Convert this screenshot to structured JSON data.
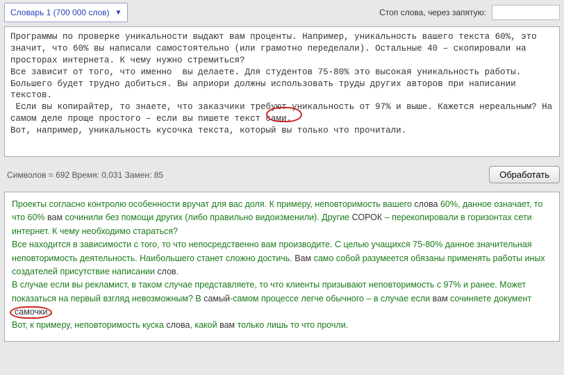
{
  "header": {
    "dictionary_label": "Словарь 1 (700 000 слов)",
    "stop_label": "Стоп слова, через запятую:",
    "stop_value": ""
  },
  "source": {
    "text": "Программы по проверке уникальности выдают вам проценты. Например, уникальность вашего текста 60%, это значит, что 60% вы написали самостоятельно (или грамотно переделали). Остальные 40 – скопировали на просторах интернета. К чему нужно стремиться?\nВсе зависит от того, что именно  вы делаете. Для студентов 75-80% это высокая уникальность работы. Большего будет трудно добиться. Вы априори должны использовать труды других авторов при написании текстов.\n Если вы копирайтер, то знаете, что заказчики требуют уникальность от 97% и выше. Кажется нереальным? На самом деле проще простого – если вы пишете текст сами.\nВот, например, уникальность кусочка текста, который вы только что прочитали."
  },
  "stats": {
    "line": "Символов = 692  Время: 0,031  Замен: 85"
  },
  "actions": {
    "process": "Обработать"
  },
  "result": {
    "p1a": "Проекты согласно контролю особенности вручат для вас доля. К примеру, неповторимость вашего ",
    "p1b": "слова",
    "p1c": " 60%, данное означает, то что 60% ",
    "p1d": "вам",
    "p1e": " сочинили без помощи других (либо правильно видоизменили). Другие ",
    "p1f": "СОРОК",
    "p1g": " – перекопировали в горизонтах сети интернет. К чему необходимо стараться?",
    "p2a": "Все находится в зависимости с того, то что непосредственно вам производите. С целью учащихся 75-80% данное значительная неповторимость деятельность. Наибольшего станет сложно достичь. ",
    "p2b": "Вам",
    "p2c": " само собой разумеется обязаны применять работы иных создателей присутствие написании ",
    "p2d": "слов",
    "p2e": ".",
    "p3a": "В случае если вы рекламист, в таком случае представляете, то что клиенты призывают неповторимость с 97% и ранее. Может показаться на первый взгляд невозможным? В ",
    "p3b": "самый",
    "p3c": "-самом процессе легче обычного – в случае если ",
    "p3d": "вам",
    "p3e": " сочиняете документ ",
    "p3f": "самочки",
    "p3g": ".",
    "p4a": "Вот, к примеру, неповторимость куска ",
    "p4b": "слова",
    "p4c": ", какой ",
    "p4d": "вам",
    "p4e": " только лишь то что прочли."
  }
}
